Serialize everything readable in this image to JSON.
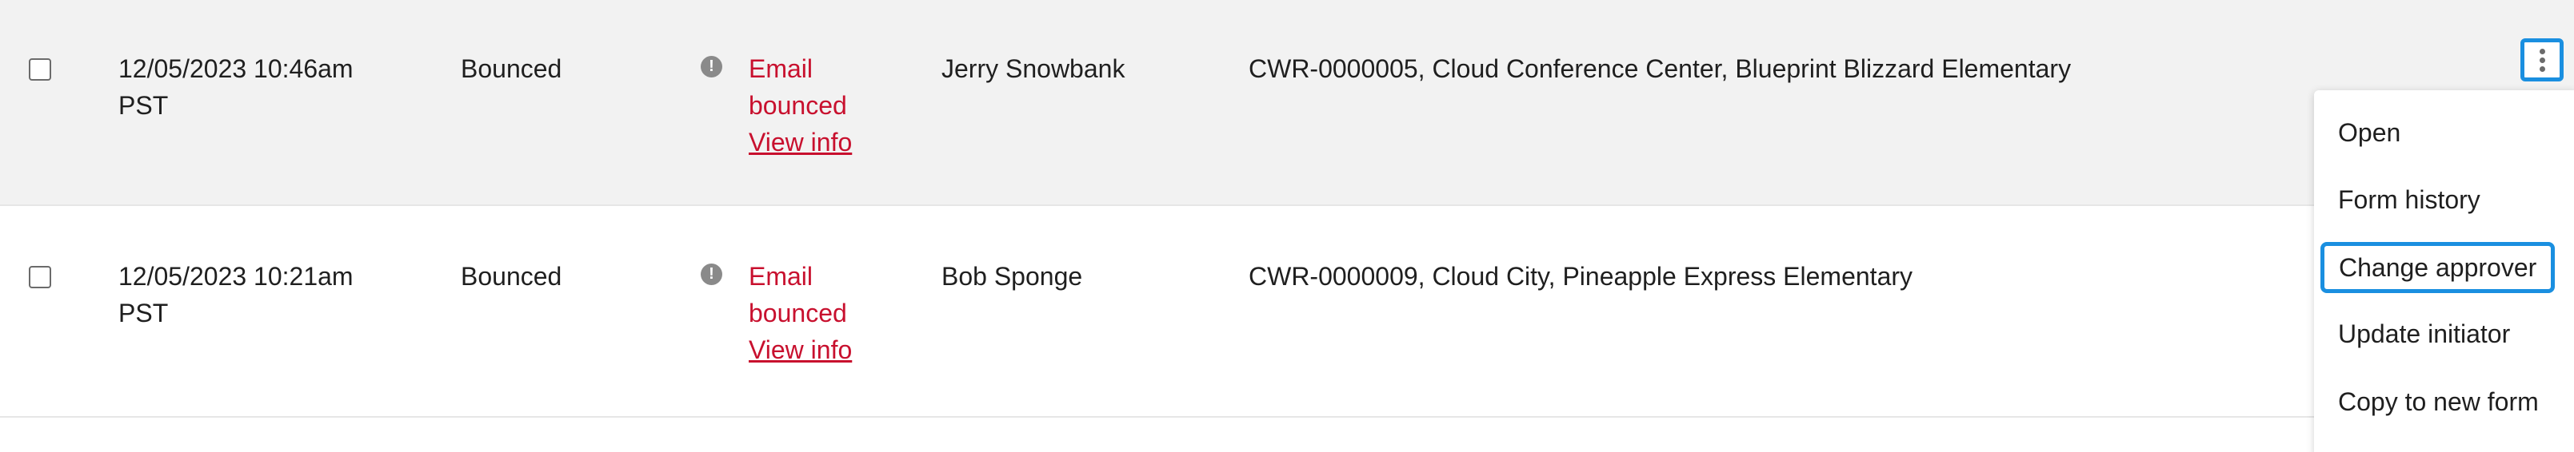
{
  "rows": [
    {
      "date": "12/05/2023 10:46am PST",
      "status": "Bounced",
      "message_line1": "Email",
      "message_line2": "bounced",
      "view_info": "View info",
      "name": "Jerry Snowbank",
      "form": "CWR-0000005, Cloud Conference Center, Blueprint Blizzard Elementary"
    },
    {
      "date": "12/05/2023 10:21am PST",
      "status": "Bounced",
      "message_line1": "Email",
      "message_line2": "bounced",
      "view_info": "View info",
      "name": "Bob Sponge",
      "form": "CWR-0000009, Cloud City, Pineapple Express Elementary"
    }
  ],
  "icons": {
    "warning": "exclamation-circle-icon",
    "actions": "kebab-menu-icon"
  },
  "colors": {
    "error_text": "#c8102e",
    "focus_outline": "#1a8fe0",
    "hover_row": "#f2f2f2"
  },
  "menu": {
    "items": [
      "Open",
      "Form history",
      "Change approver",
      "Update initiator",
      "Copy to new form"
    ]
  }
}
